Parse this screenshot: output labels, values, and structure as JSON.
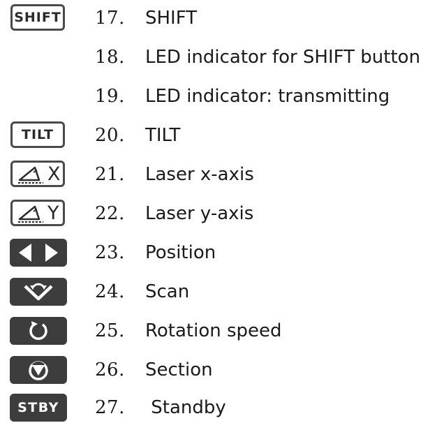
{
  "items": [
    {
      "icon": "shift-key-icon",
      "key_text": "SHIFT",
      "number": "17.",
      "label": "SHIFT"
    },
    {
      "icon": "",
      "number": "18.",
      "label": "LED indicator for SHIFT button"
    },
    {
      "icon": "",
      "number": "19.",
      "label": "LED indicator: transmitting"
    },
    {
      "icon": "tilt-key-icon",
      "key_text": "TILT",
      "number": "20.",
      "label": "TILT"
    },
    {
      "icon": "laser-x-axis-key-icon",
      "key_text": "X",
      "number": "21.",
      "label": "Laser x-axis"
    },
    {
      "icon": "laser-y-axis-key-icon",
      "key_text": "Y",
      "number": "22.",
      "label": "Laser y-axis"
    },
    {
      "icon": "position-arrows-key-icon",
      "number": "23.",
      "label": "Position"
    },
    {
      "icon": "scan-key-icon",
      "number": "24.",
      "label": "Scan"
    },
    {
      "icon": "rotation-speed-key-icon",
      "number": "25.",
      "label": "Rotation speed"
    },
    {
      "icon": "section-key-icon",
      "number": "26.",
      "label": "Section"
    },
    {
      "icon": "standby-key-icon",
      "key_text": "STBY",
      "number": "27.",
      "label": " Standby"
    }
  ],
  "colors": {
    "key_dark": "#3d3d3d",
    "key_outline": "#4a4a4a",
    "text": "#1a1a1a"
  }
}
